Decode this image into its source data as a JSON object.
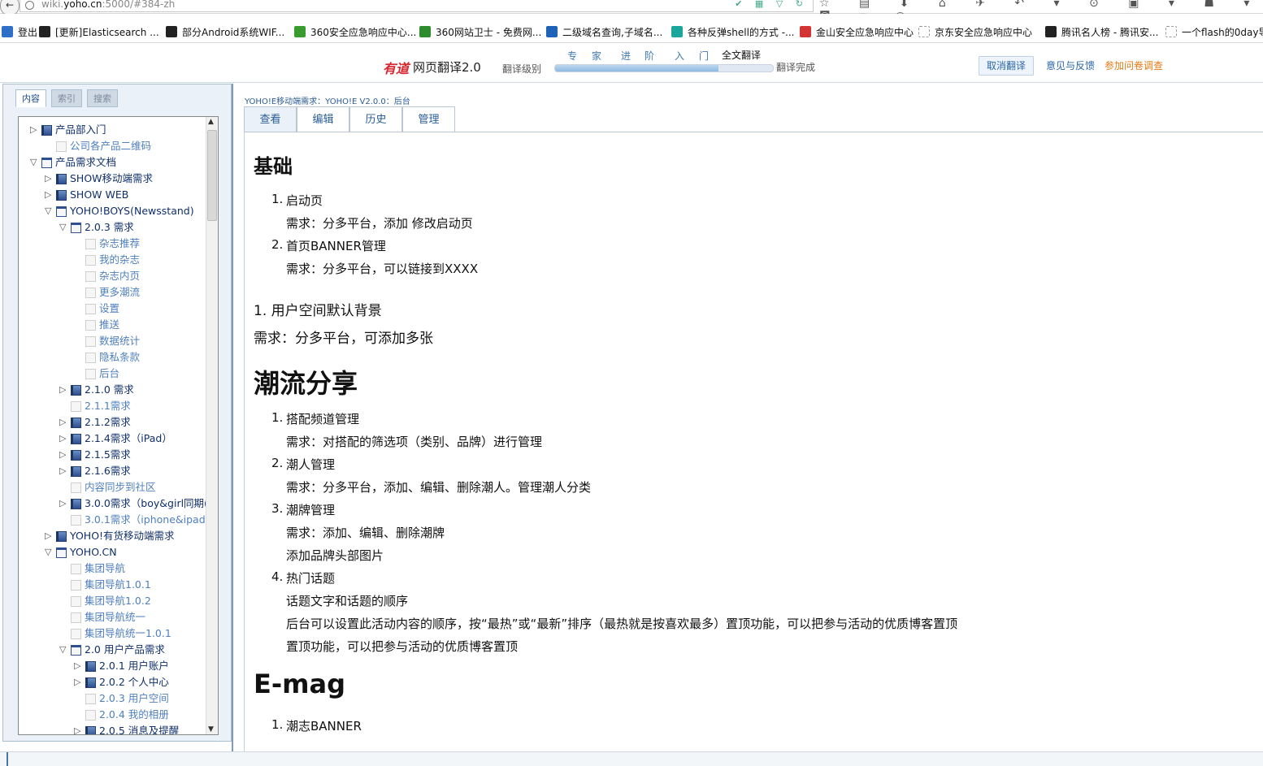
{
  "browser": {
    "url_prefix": "wiki.",
    "url_host": "yoho.cn",
    "url_rest": ":5000/#384-zh"
  },
  "bookmarks": [
    {
      "label": "登出",
      "color": "#2f6fc7"
    },
    {
      "label": "[更新]Elasticsearch ...",
      "color": "#222222"
    },
    {
      "label": "部分Android系统WIF...",
      "color": "#222222"
    },
    {
      "label": "360安全应急响应中心...",
      "color": "#3a9b2e"
    },
    {
      "label": "360网站卫士 - 免费网...",
      "color": "#2e8b2e"
    },
    {
      "label": "二级域名查询,子域名...",
      "color": "#1d63b8"
    },
    {
      "label": "各种反弹shell的方式 -...",
      "color": "#1aa69a"
    },
    {
      "label": "金山安全应急响应中心",
      "color": "#d43333"
    },
    {
      "label": "京东安全应急响应中心",
      "color": "#ffffff"
    },
    {
      "label": "腾讯名人榜 - 腾讯安...",
      "color": "#222222"
    },
    {
      "label": "一个flash的0day导...",
      "color": "#ffffff"
    }
  ],
  "youdao": {
    "logo": "有道",
    "name": "网页翻译2.0",
    "level_label": "翻译级别",
    "steps": [
      "专",
      "家",
      "进",
      "阶",
      "入",
      "门"
    ],
    "current": "全文翻译",
    "done": "翻译完成",
    "progress": 0.75,
    "cancel": "取消翻译",
    "feedback": "意见与反馈",
    "survey": "参加问卷调查"
  },
  "nav_tabs": [
    "内容",
    "索引",
    "搜索"
  ],
  "tree": [
    {
      "label": "产品部入门",
      "indent": 0,
      "type": "folder",
      "twisty": "closed"
    },
    {
      "label": "公司各产品二维码",
      "indent": 1,
      "type": "page",
      "twisty": ""
    },
    {
      "label": "产品需求文档",
      "indent": 0,
      "type": "open",
      "twisty": "open"
    },
    {
      "label": "SHOW移动端需求",
      "indent": 1,
      "type": "folder",
      "twisty": "closed"
    },
    {
      "label": "SHOW WEB",
      "indent": 1,
      "type": "folder",
      "twisty": "closed"
    },
    {
      "label": "YOHO!BOYS(Newsstand)",
      "indent": 1,
      "type": "open",
      "twisty": "open"
    },
    {
      "label": "2.0.3 需求",
      "indent": 2,
      "type": "open",
      "twisty": "open"
    },
    {
      "label": "杂志推荐",
      "indent": 3,
      "type": "page",
      "twisty": ""
    },
    {
      "label": "我的杂志",
      "indent": 3,
      "type": "page",
      "twisty": ""
    },
    {
      "label": "杂志内页",
      "indent": 3,
      "type": "page",
      "twisty": ""
    },
    {
      "label": "更多潮流",
      "indent": 3,
      "type": "page",
      "twisty": ""
    },
    {
      "label": "设置",
      "indent": 3,
      "type": "page",
      "twisty": ""
    },
    {
      "label": "推送",
      "indent": 3,
      "type": "page",
      "twisty": ""
    },
    {
      "label": "数据统计",
      "indent": 3,
      "type": "page",
      "twisty": ""
    },
    {
      "label": "隐私条款",
      "indent": 3,
      "type": "page",
      "twisty": ""
    },
    {
      "label": "后台",
      "indent": 3,
      "type": "page",
      "twisty": ""
    },
    {
      "label": "2.1.0 需求",
      "indent": 2,
      "type": "folder",
      "twisty": "closed"
    },
    {
      "label": "2.1.1需求",
      "indent": 2,
      "type": "page",
      "twisty": ""
    },
    {
      "label": "2.1.2需求",
      "indent": 2,
      "type": "folder",
      "twisty": "closed"
    },
    {
      "label": "2.1.4需求（iPad）",
      "indent": 2,
      "type": "folder",
      "twisty": "closed"
    },
    {
      "label": "2.1.5需求",
      "indent": 2,
      "type": "folder",
      "twisty": "closed"
    },
    {
      "label": "2.1.6需求",
      "indent": 2,
      "type": "folder",
      "twisty": "closed"
    },
    {
      "label": "内容同步到社区",
      "indent": 2,
      "type": "page",
      "twisty": ""
    },
    {
      "label": "3.0.0需求（boy&girl同期(",
      "indent": 2,
      "type": "folder",
      "twisty": "closed"
    },
    {
      "label": "3.0.1需求（iphone&ipad",
      "indent": 2,
      "type": "page",
      "twisty": ""
    },
    {
      "label": "YOHO!有货移动端需求",
      "indent": 1,
      "type": "folder",
      "twisty": "closed"
    },
    {
      "label": "YOHO.CN",
      "indent": 1,
      "type": "open",
      "twisty": "open"
    },
    {
      "label": "集团导航",
      "indent": 2,
      "type": "page",
      "twisty": ""
    },
    {
      "label": "集团导航1.0.1",
      "indent": 2,
      "type": "page",
      "twisty": ""
    },
    {
      "label": "集团导航1.0.2",
      "indent": 2,
      "type": "page",
      "twisty": ""
    },
    {
      "label": "集团导航统一",
      "indent": 2,
      "type": "page",
      "twisty": ""
    },
    {
      "label": "集团导航统一1.0.1",
      "indent": 2,
      "type": "page",
      "twisty": ""
    },
    {
      "label": "2.0 用户产品需求",
      "indent": 2,
      "type": "open",
      "twisty": "open"
    },
    {
      "label": "2.0.1 用户账户",
      "indent": 3,
      "type": "folder",
      "twisty": "closed"
    },
    {
      "label": "2.0.2 个人中心",
      "indent": 3,
      "type": "folder",
      "twisty": "closed"
    },
    {
      "label": "2.0.3 用户空间",
      "indent": 3,
      "type": "page",
      "twisty": ""
    },
    {
      "label": "2.0.4 我的相册",
      "indent": 3,
      "type": "page",
      "twisty": ""
    },
    {
      "label": "2.0.5 消息及提醒",
      "indent": 3,
      "type": "folder",
      "twisty": "closed"
    }
  ],
  "breadcrumb": "YOHO!E移动端需求：YOHO!E V2.0.0：后台",
  "content_tabs": [
    "查看",
    "编辑",
    "历史",
    "管理"
  ],
  "content": [
    {
      "kind": "h2",
      "text": "基础"
    },
    {
      "kind": "li",
      "num": "1.",
      "text": "启动页"
    },
    {
      "kind": "p",
      "text": "需求：分多平台，添加 修改启动页"
    },
    {
      "kind": "li",
      "num": "2.",
      "text": "首页BANNER管理"
    },
    {
      "kind": "p",
      "text": "需求：分多平台，可以链接到XXXX"
    },
    {
      "kind": "big",
      "text": "1. 用户空间默认背景"
    },
    {
      "kind": "big",
      "text": "需求：分多平台，可添加多张"
    },
    {
      "kind": "h1",
      "text": "潮流分享"
    },
    {
      "kind": "li",
      "num": "1.",
      "text": "搭配频道管理"
    },
    {
      "kind": "p",
      "text": "需求：对搭配的筛选项（类别、品牌）进行管理"
    },
    {
      "kind": "li",
      "num": "2.",
      "text": "潮人管理"
    },
    {
      "kind": "p",
      "text": "需求：分多平台，添加、编辑、删除潮人。管理潮人分类"
    },
    {
      "kind": "li",
      "num": "3.",
      "text": "潮牌管理"
    },
    {
      "kind": "p",
      "text": "需求：添加、编辑、删除潮牌"
    },
    {
      "kind": "p",
      "text": "添加品牌头部图片"
    },
    {
      "kind": "li",
      "num": "4.",
      "text": "热门话题"
    },
    {
      "kind": "p",
      "text": "话题文字和话题的顺序"
    },
    {
      "kind": "p",
      "text": "后台可以设置此活动内容的顺序，按“最热”或“最新”排序（最热就是按喜欢最多）置顶功能，可以把参与活动的优质博客置顶"
    },
    {
      "kind": "p",
      "text": "置顶功能，可以把参与活动的优质博客置顶"
    },
    {
      "kind": "h1",
      "text": "E-mag"
    },
    {
      "kind": "li",
      "num": "1.",
      "text": "潮志BANNER"
    }
  ]
}
